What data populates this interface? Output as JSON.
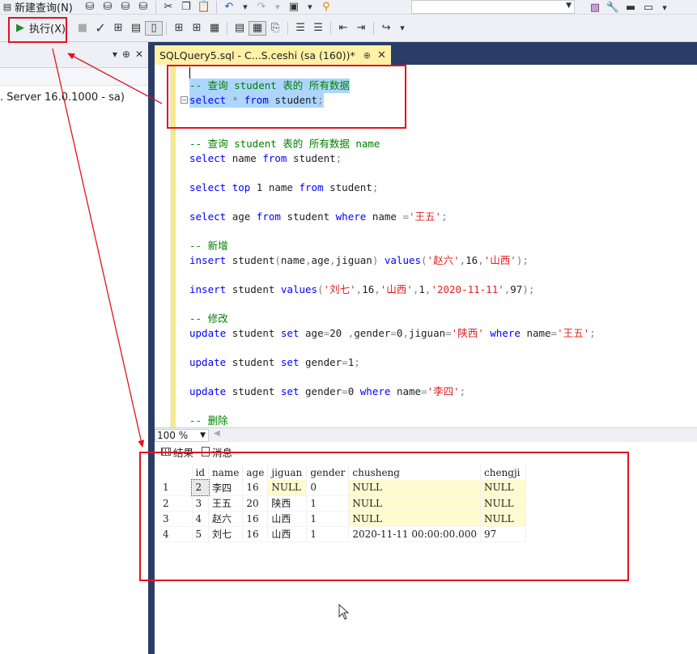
{
  "toolbar1": {
    "new_query_label": "新建查询(N)"
  },
  "toolbar2": {
    "execute_label": "执行(X)"
  },
  "left_panel": {
    "server_node": ". Server 16.0.1000 - sa)"
  },
  "tab": {
    "title": "SQLQuery5.sql - C...S.ceshi (sa (160))*",
    "pin": "⊕",
    "close": "✕"
  },
  "editor": {
    "lines": [
      {
        "text": "-- 查询 student 表的 所有数据"
      },
      {
        "text": "select * from student;"
      },
      {
        "text": "-- 查询 student 表的 所有数据 name"
      },
      {
        "text": "select name from student;"
      },
      {
        "text": "select top 1 name from student;"
      },
      {
        "text": "select age from student where name ='王五';"
      },
      {
        "text": "-- 新增"
      },
      {
        "text": "insert student(name,age,jiguan) values('赵六',16,'山西');"
      },
      {
        "text": "insert student values('刘七',16,'山西',1,'2020-11-11',97);"
      },
      {
        "text": "-- 修改"
      },
      {
        "text": "update student set age=20 ,gender=0,jiguan='陕西' where name='王五';"
      },
      {
        "text": "update student set gender=1;"
      },
      {
        "text": "update student set gender=0 where name='李四';"
      },
      {
        "text": "-- 删除"
      }
    ]
  },
  "zoom": {
    "value": "100 %"
  },
  "results": {
    "tab_results": "结果",
    "tab_messages": "消息",
    "columns": [
      "",
      "id",
      "name",
      "age",
      "jiguan",
      "gender",
      "chusheng",
      "chengji"
    ],
    "rows": [
      [
        "1",
        "2",
        "李四",
        "16",
        "NULL",
        "0",
        "NULL",
        "NULL"
      ],
      [
        "2",
        "3",
        "王五",
        "20",
        "陕西",
        "1",
        "NULL",
        "NULL"
      ],
      [
        "3",
        "4",
        "赵六",
        "16",
        "山西",
        "1",
        "NULL",
        "NULL"
      ],
      [
        "4",
        "5",
        "刘七",
        "16",
        "山西",
        "1",
        "2020-11-11 00:00:00.000",
        "97"
      ]
    ]
  },
  "colors": {
    "accent_annotation": "#e0141e",
    "tab_background": "#fff1a6",
    "dark_frame": "#2b3d66",
    "keyword": "#0000ff",
    "comment": "#008000",
    "string": "#e32020",
    "selection": "#add6ff"
  }
}
